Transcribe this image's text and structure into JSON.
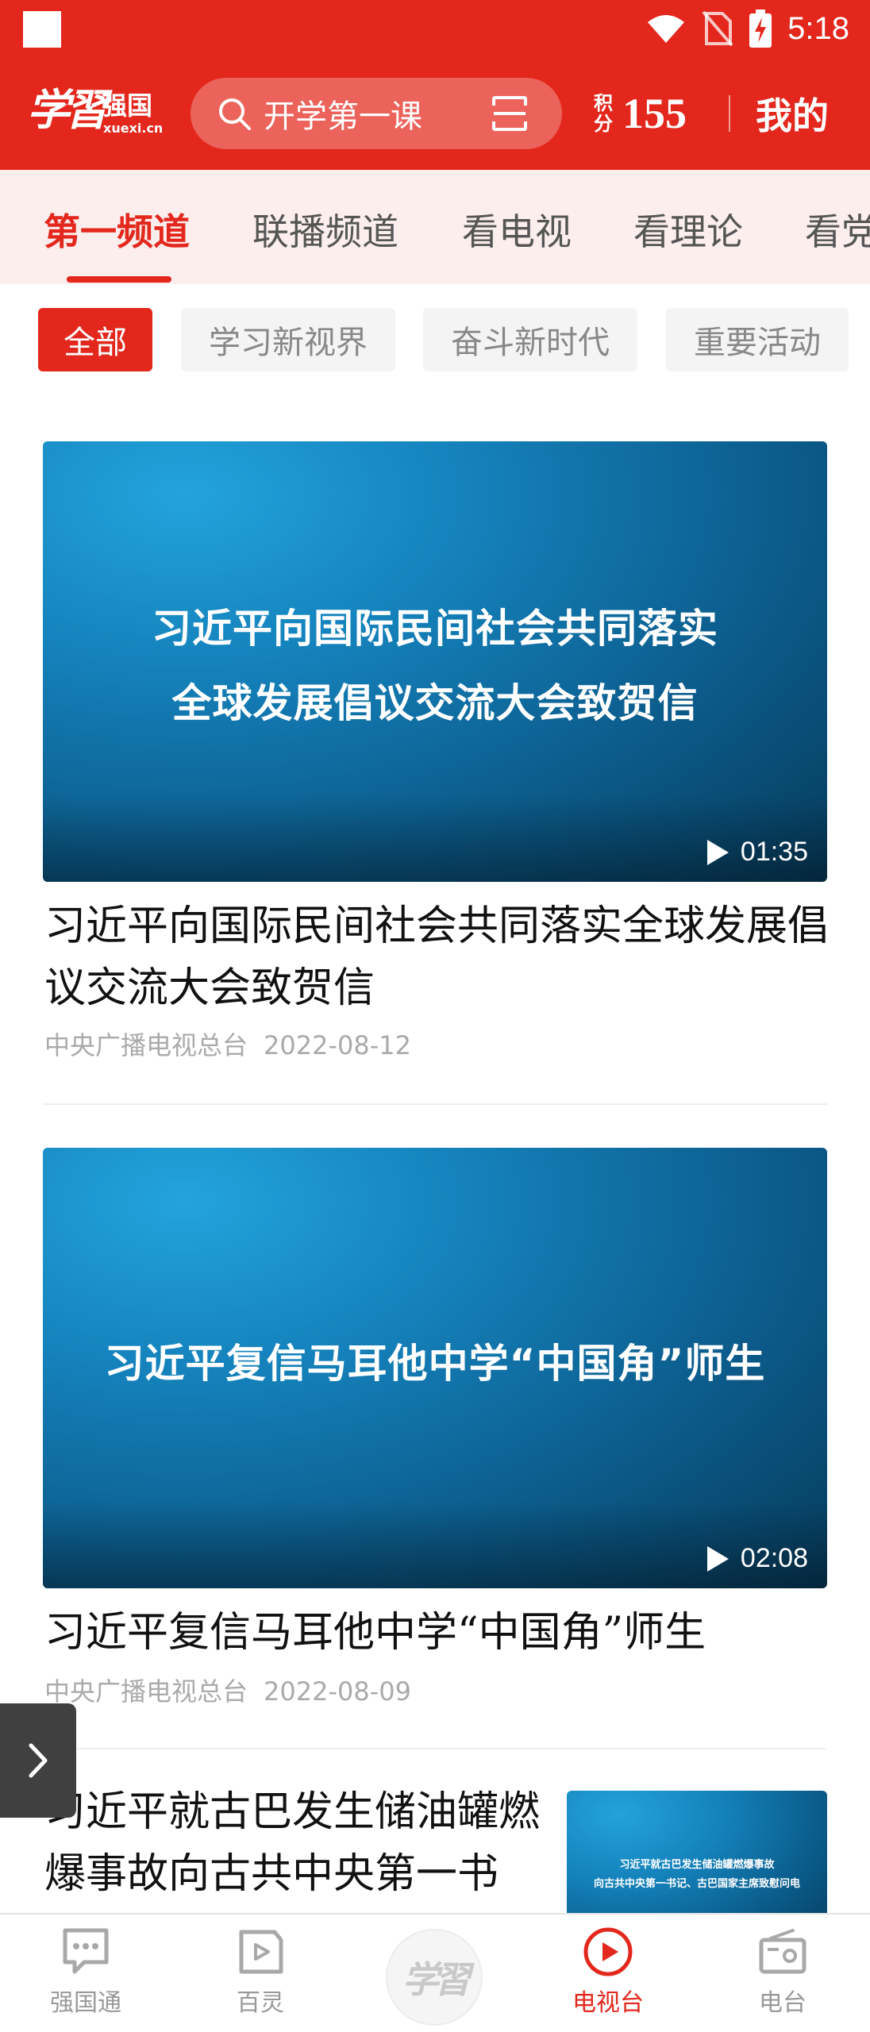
{
  "status_bar": {
    "time": "5:18"
  },
  "header": {
    "logo_script": "学習",
    "logo_name": "强国",
    "logo_domain": "xuexi.cn",
    "search_placeholder": "开学第一课",
    "points_label_top": "积",
    "points_label_bottom": "分",
    "points_value": "155",
    "mine_label": "我的"
  },
  "channel_tabs": [
    {
      "label": "第一频道",
      "active": true
    },
    {
      "label": "联播频道",
      "active": false
    },
    {
      "label": "看电视",
      "active": false
    },
    {
      "label": "看理论",
      "active": false
    },
    {
      "label": "看党",
      "active": false
    }
  ],
  "filter_chips": [
    {
      "label": "全部",
      "active": true
    },
    {
      "label": "学习新视界",
      "active": false
    },
    {
      "label": "奋斗新时代",
      "active": false
    },
    {
      "label": "重要活动",
      "active": false
    }
  ],
  "videos": [
    {
      "thumb_lines": [
        "习近平向国际民间社会共同落实",
        "全球发展倡议交流大会致贺信"
      ],
      "duration": "01:35",
      "title": "习近平向国际民间社会共同落实全球发展倡议交流大会致贺信",
      "source": "中央广播电视总台",
      "date": "2022-08-12"
    },
    {
      "thumb_lines": [
        "习近平复信马耳他中学“中国角”师生"
      ],
      "duration": "02:08",
      "title": "习近平复信马耳他中学“中国角”师生",
      "source": "中央广播电视总台",
      "date": "2022-08-09"
    },
    {
      "thumb_lines": [
        "习近平就古巴发生储油罐燃爆事故",
        "向古共中央第一书记、古巴国家主席致慰问电"
      ],
      "title": "习近平就古巴发生储油罐燃爆事故向古共中央第一书"
    }
  ],
  "bottom_nav": [
    {
      "label": "强国通",
      "icon": "chat-icon",
      "active": false
    },
    {
      "label": "百灵",
      "icon": "play-square-icon",
      "active": false
    },
    {
      "label": "学習",
      "icon": "xuexi-logo",
      "active": false
    },
    {
      "label": "电视台",
      "icon": "play-circle-icon",
      "active": true
    },
    {
      "label": "电台",
      "icon": "radio-icon",
      "active": false
    }
  ],
  "colors": {
    "brand_red": "#e3271c",
    "tab_bg": "#fbeeed",
    "meta_gray": "#aaaaaa"
  }
}
